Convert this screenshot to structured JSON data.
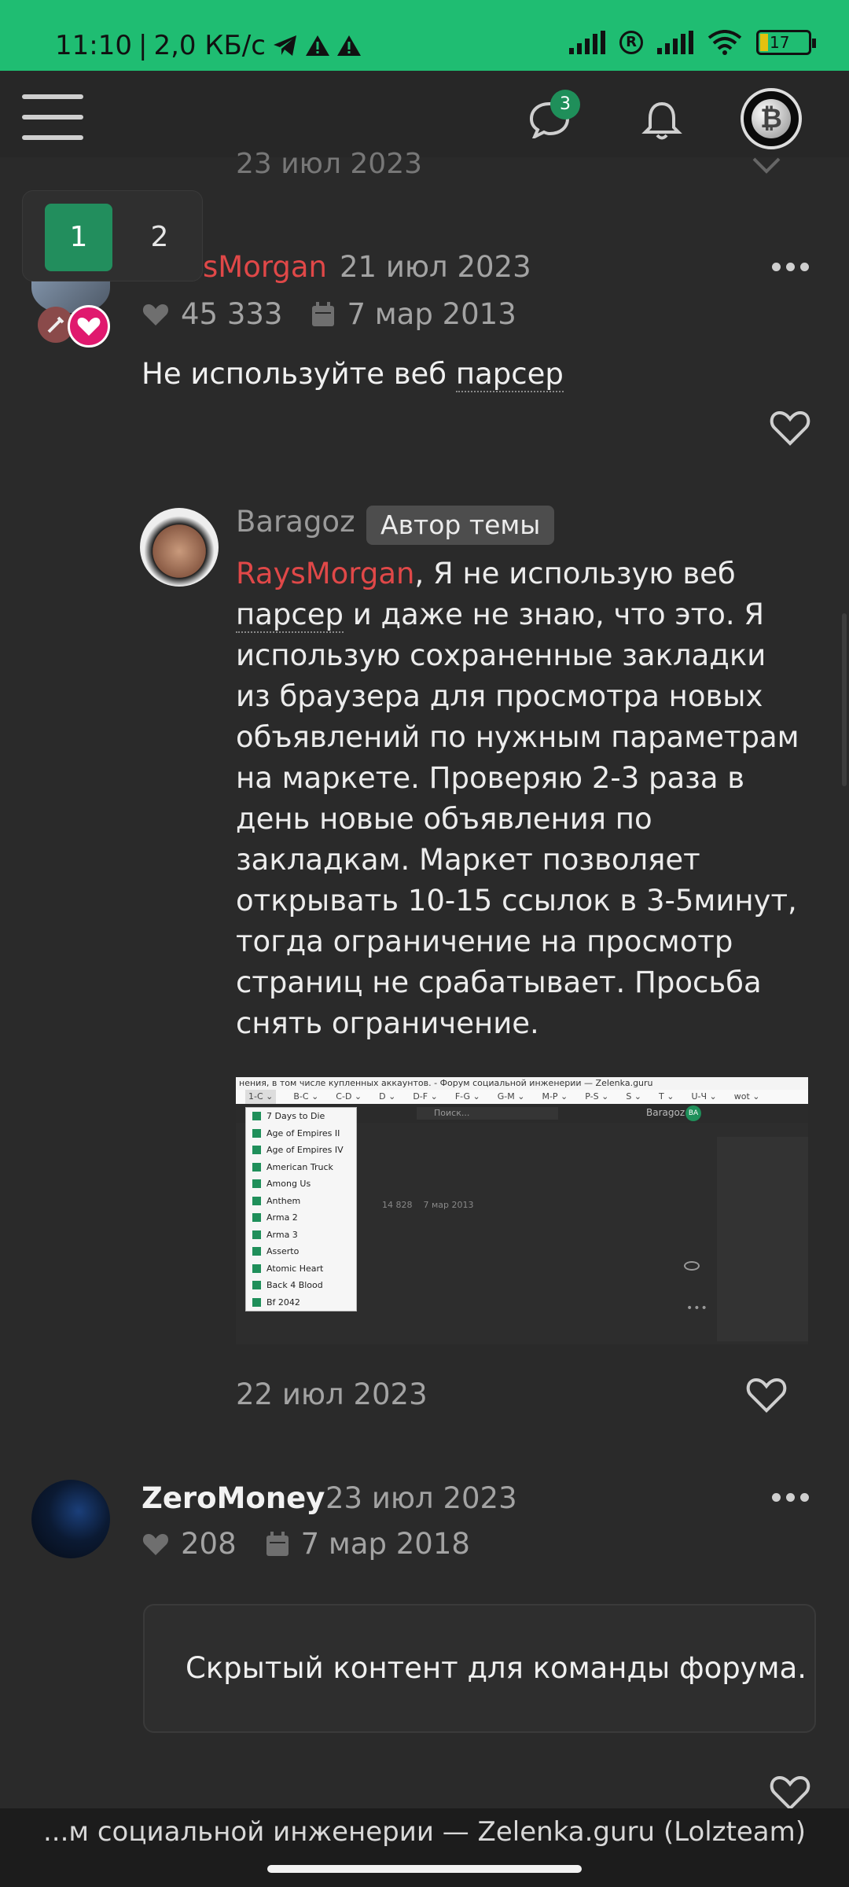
{
  "status_bar": {
    "time": "11:10",
    "speed": "2,0 КБ/с",
    "battery": "17"
  },
  "top_nav": {
    "messages_badge": "3",
    "avatar_glyph": "₿"
  },
  "pagination": {
    "current": "1",
    "next": "2"
  },
  "previous_post_date": "23 июл 2023",
  "post1": {
    "author": "RaysMorgan",
    "author_visible": "sMorgan",
    "date": "21 июл 2023",
    "likes": "45 333",
    "registered": "7 мар 2013",
    "text_before": "Не используйте веб ",
    "text_term": "парсер"
  },
  "reply": {
    "author": "Baragoz",
    "badge": "Автор темы",
    "mention": "RaysMorgan",
    "text_intro": ", Я не использую веб ",
    "text_term": "парсер",
    "text_rest": " и даже не знаю, что это. Я использую сохраненные закладки из браузера для просмотра новых объявлений по нужным параметрам на маркете. Проверяю 2-3 раза в день новые объявления по закладкам. Маркет позволяет открывать 10-15 ссылок в 3-5минут, тогда ограничение на просмотр страниц не срабатывает. Просьба снять ограничение.",
    "date": "22 июл 2023",
    "screenshot": {
      "title_text": "нения, в том числе купленных аккаунтов. - Форум социальной инженерии — Zelenka.guru",
      "tabs": [
        "1-C ⌄",
        "B-C ⌄",
        "C-D ⌄",
        "D ⌄",
        "D-F ⌄",
        "F-G ⌄",
        "G-M ⌄",
        "M-P ⌄",
        "P-S ⌄",
        "S ⌄",
        "T ⌄",
        "U-Ч ⌄",
        "wot ⌄"
      ],
      "search_placeholder": "Поиск...",
      "user": "Baragoz",
      "user_initials": "BA",
      "menu_items": [
        "7 Days to Die",
        "Age of Empires II",
        "Age of Empires IV",
        "American Truck",
        "Among Us",
        "Anthem",
        "Arma 2",
        "Arma 3",
        "Asserto",
        "Atomic Heart",
        "Back 4 Blood",
        "Bf 2042"
      ],
      "stats_likes": "14 828",
      "stats_date": "7 мар 2013"
    }
  },
  "post2": {
    "author": "ZeroMoney",
    "date": "23 июл 2023",
    "likes": "208",
    "registered": "7 мар 2018",
    "hidden_text": "Скрытый контент для команды форума."
  },
  "footer": {
    "page_title": "...м социальной инженерии — Zelenka.guru (Lolzteam)"
  },
  "colors": {
    "status_bar": "#1fbd72",
    "accent_green": "#228e5d",
    "username_red": "#e04848",
    "background": "#2a2a2a"
  }
}
